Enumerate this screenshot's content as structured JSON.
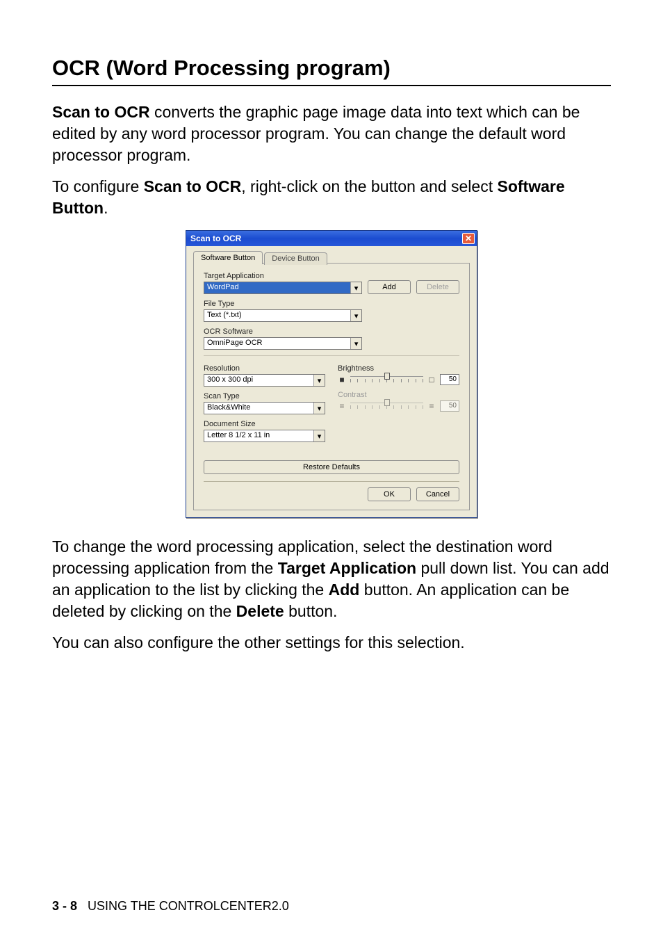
{
  "page": {
    "heading": "OCR (Word Processing program)",
    "p1_a": "Scan to OCR",
    "p1_b": " converts the graphic page image data into text which can be edited by any word processor program. You can change the default word processor program.",
    "p2_a": "To configure ",
    "p2_b": "Scan to OCR",
    "p2_c": ", right-click on the button and select ",
    "p2_d": "Software Button",
    "p2_e": ".",
    "p3_a": "To change the word processing application, select the destination word processing application from the ",
    "p3_b": "Target Application",
    "p3_c": " pull down list. You can add an application to the list by clicking the ",
    "p3_d": "Add",
    "p3_e": " button. An application can be deleted by clicking on the ",
    "p3_f": "Delete",
    "p3_g": " button.",
    "p4": "You can also configure the other settings for this selection."
  },
  "dialog": {
    "title": "Scan to OCR",
    "tabs": {
      "active": "Software Button",
      "inactive": "Device Button"
    },
    "labels": {
      "target_app": "Target Application",
      "file_type": "File Type",
      "ocr_software": "OCR Software",
      "resolution": "Resolution",
      "scan_type": "Scan Type",
      "document_size": "Document Size",
      "brightness": "Brightness",
      "contrast": "Contrast"
    },
    "values": {
      "target_app": "WordPad",
      "file_type": "Text (*.txt)",
      "ocr_software": "OmniPage OCR",
      "resolution": "300 x 300 dpi",
      "scan_type": "Black&White",
      "document_size": "Letter 8 1/2 x 11 in",
      "brightness": "50",
      "contrast": "50"
    },
    "buttons": {
      "add": "Add",
      "delete": "Delete",
      "restore": "Restore Defaults",
      "ok": "OK",
      "cancel": "Cancel"
    }
  },
  "footer": {
    "page_ref": "3 - 8",
    "chapter": "USING THE CONTROLCENTER2.0"
  }
}
